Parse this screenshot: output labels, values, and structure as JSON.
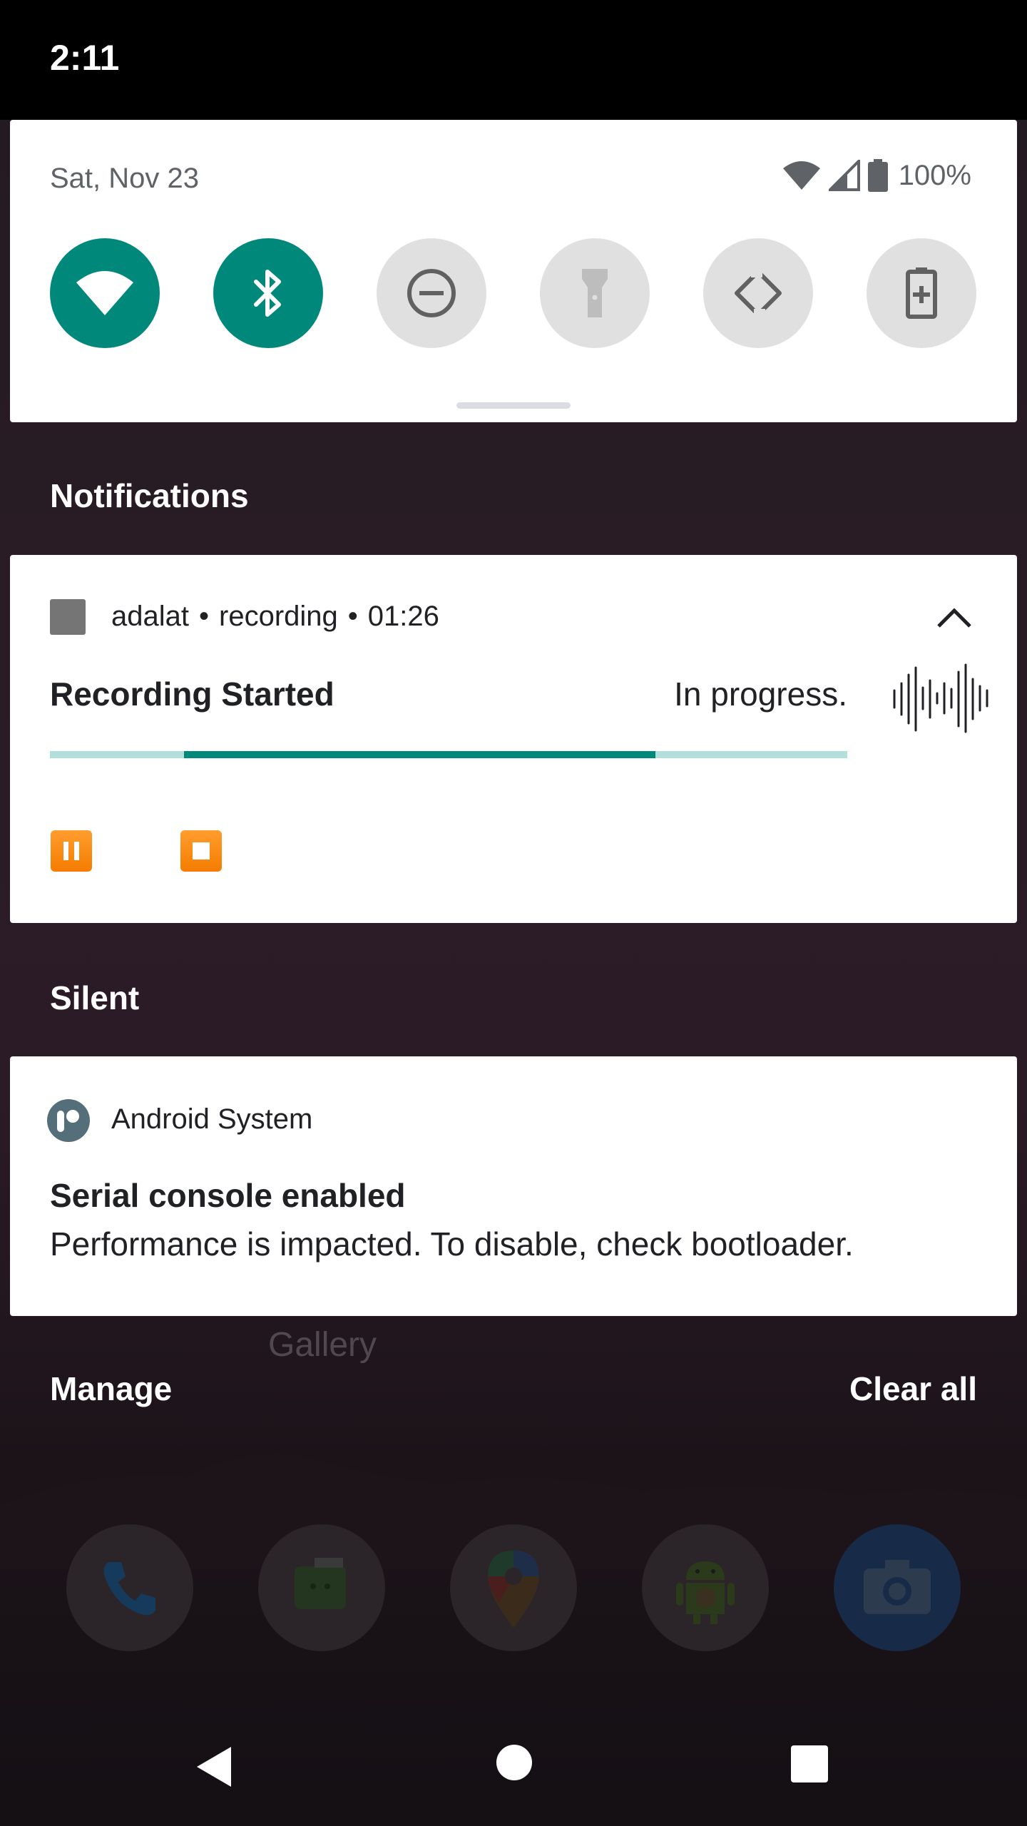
{
  "status_bar": {
    "time": "2:11"
  },
  "quick_settings": {
    "date": "Sat, Nov 23",
    "battery_percent": "100%",
    "tiles": [
      {
        "name": "wifi",
        "icon": "wifi-icon",
        "state": "on"
      },
      {
        "name": "bluetooth",
        "icon": "bluetooth-icon",
        "state": "on"
      },
      {
        "name": "do-not-disturb",
        "icon": "minus-circle-icon",
        "state": "off"
      },
      {
        "name": "flashlight",
        "icon": "flashlight-icon",
        "state": "off"
      },
      {
        "name": "auto-rotate",
        "icon": "rotate-icon",
        "state": "off"
      },
      {
        "name": "battery-saver",
        "icon": "battery-plus-icon",
        "state": "off"
      }
    ]
  },
  "sections": {
    "notifications": "Notifications",
    "silent": "Silent"
  },
  "recording_notification": {
    "app": "adalat",
    "channel": "recording",
    "elapsed": "01:26",
    "separator": "•",
    "title": "Recording Started",
    "status": "In progress.",
    "progress_start": 0.168,
    "progress_end": 0.759,
    "actions": [
      {
        "name": "pause",
        "icon": "pause-icon"
      },
      {
        "name": "stop",
        "icon": "stop-icon"
      }
    ]
  },
  "system_notification": {
    "app": "Android System",
    "title": "Serial console enabled",
    "text": "Performance is impacted. To disable, check bootloader."
  },
  "home_screen": {
    "label": "Gallery",
    "dock": [
      "phone-icon",
      "messages-icon",
      "maps-icon",
      "android-app-icon",
      "camera-icon"
    ]
  },
  "footer": {
    "manage": "Manage",
    "clear_all": "Clear all"
  },
  "colors": {
    "accent": "#00897b",
    "accent_light": "#b2dfdb",
    "action_orange": "#f57c00"
  }
}
